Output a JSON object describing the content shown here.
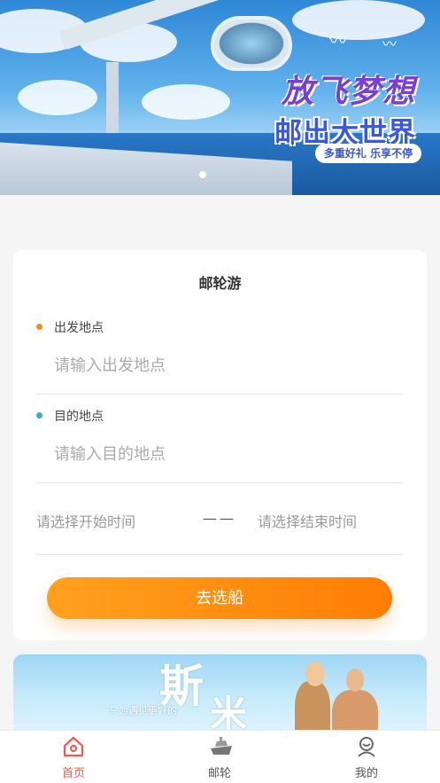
{
  "banner": {
    "slogan_line1": "放飞梦想",
    "slogan_line2": "邮出大世界",
    "slogan_tag": "多重好礼 乐享不停",
    "carousel_index": 1,
    "carousel_count": 1
  },
  "form": {
    "title": "邮轮游",
    "departure_label": "出发地点",
    "departure_placeholder": "请输入出发地点",
    "destination_label": "目的地点",
    "destination_placeholder": "请输入目的地点",
    "start_date_placeholder": "请选择开始时间",
    "date_separator": "——",
    "end_date_placeholder": "请选择结束时间",
    "submit_label": "去选船",
    "colors": {
      "departure_dot": "#f58a1f",
      "destination_dot": "#2bb5b8",
      "button_start": "#ffa11e",
      "button_end": "#ff7d05"
    }
  },
  "promo": {
    "big_text_1": "斯",
    "big_text_2": "米",
    "small_text": "只为遇见更好的"
  },
  "tabbar": {
    "items": [
      {
        "label": "首页",
        "icon": "home-icon",
        "active": true
      },
      {
        "label": "邮轮",
        "icon": "ship-icon",
        "active": false
      },
      {
        "label": "我的",
        "icon": "profile-icon",
        "active": false
      }
    ],
    "active_color": "#f35a4c"
  }
}
